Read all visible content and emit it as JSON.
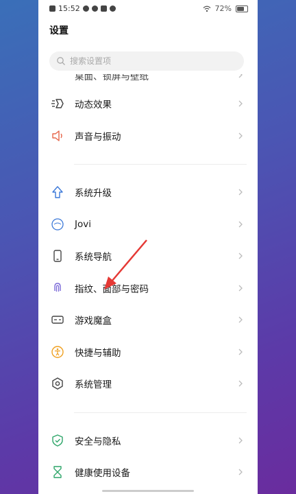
{
  "status": {
    "time": "15:52",
    "battery": "72%"
  },
  "page_title": "设置",
  "search": {
    "placeholder": "搜索设置项"
  },
  "items": {
    "wallpaper": "桌面、锁屏与壁纸",
    "animation": "动态效果",
    "sound": "声音与振动",
    "update": "系统升级",
    "jovi": "Jovi",
    "navigation": "系统导航",
    "biometrics": "指纹、面部与密码",
    "game": "游戏魔盒",
    "shortcut": "快捷与辅助",
    "system_mgmt": "系统管理",
    "security": "安全与隐私",
    "health": "健康使用设备"
  },
  "colors": {
    "annotation_arrow": "#e53935",
    "accent_blue": "#3b78d8"
  }
}
